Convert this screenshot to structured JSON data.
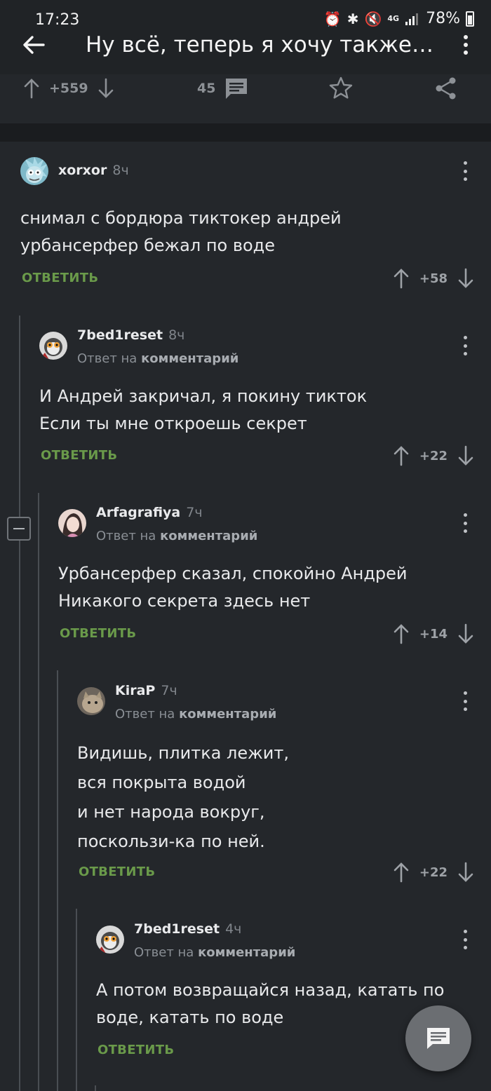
{
  "status_bar": {
    "time": "17:23",
    "network": "4G",
    "battery": "78%"
  },
  "toolbar": {
    "title": "Ну всё, теперь я хочу также в..."
  },
  "post": {
    "rating": "+559",
    "comments_count": "45"
  },
  "comments": [
    {
      "author": "xorxor",
      "time": "8ч",
      "text": "снимал с бордюра тиктокер андрей\nурбансерфер бежал по воде",
      "reply_label": "ОТВЕТИТЬ",
      "rating": "+58"
    },
    {
      "author": "7bed1reset",
      "time": "8ч",
      "reply_to_prefix": "Ответ на",
      "reply_to_target": "комментарий",
      "text": "И Андрей закричал, я покину тикток\nЕсли ты мне откроешь секрет",
      "reply_label": "ОТВЕТИТЬ",
      "rating": "+22"
    },
    {
      "author": "Arfagrafiya",
      "time": "7ч",
      "reply_to_prefix": "Ответ на",
      "reply_to_target": "комментарий",
      "text": "Урбансерфер сказал, спокойно Андрей\nНикакого секрета здесь нет",
      "reply_label": "ОТВЕТИТЬ",
      "rating": "+14"
    },
    {
      "author": "KiraP",
      "time": "7ч",
      "reply_to_prefix": "Ответ на",
      "reply_to_target": "комментарий",
      "text": "Видишь, плитка лежит,\nвся покрыта водой\nи нет народа вокруг,\nпоскользи-ка по ней.",
      "reply_label": "ОТВЕТИТЬ",
      "rating": "+22"
    },
    {
      "author": "7bed1reset",
      "time": "4ч",
      "reply_to_prefix": "Ответ на",
      "reply_to_target": "комментарий",
      "text": "А потом возвращайся назад, катать по\nводе, катать по воде",
      "reply_label": "ОТВЕТИТЬ"
    }
  ],
  "icons": {
    "back": "arrow-left-icon",
    "menu": "more-vertical-icon",
    "upvote": "arrow-up-icon",
    "downvote": "arrow-down-icon",
    "comments": "comment-icon",
    "save": "star-icon",
    "share": "share-icon",
    "fab": "write-comment-icon"
  },
  "colors": {
    "background": "#24272b",
    "toolbar": "#202326",
    "reply_accent": "#6a9a4a",
    "text": "#e8e9eb",
    "muted": "#8a8f95"
  }
}
